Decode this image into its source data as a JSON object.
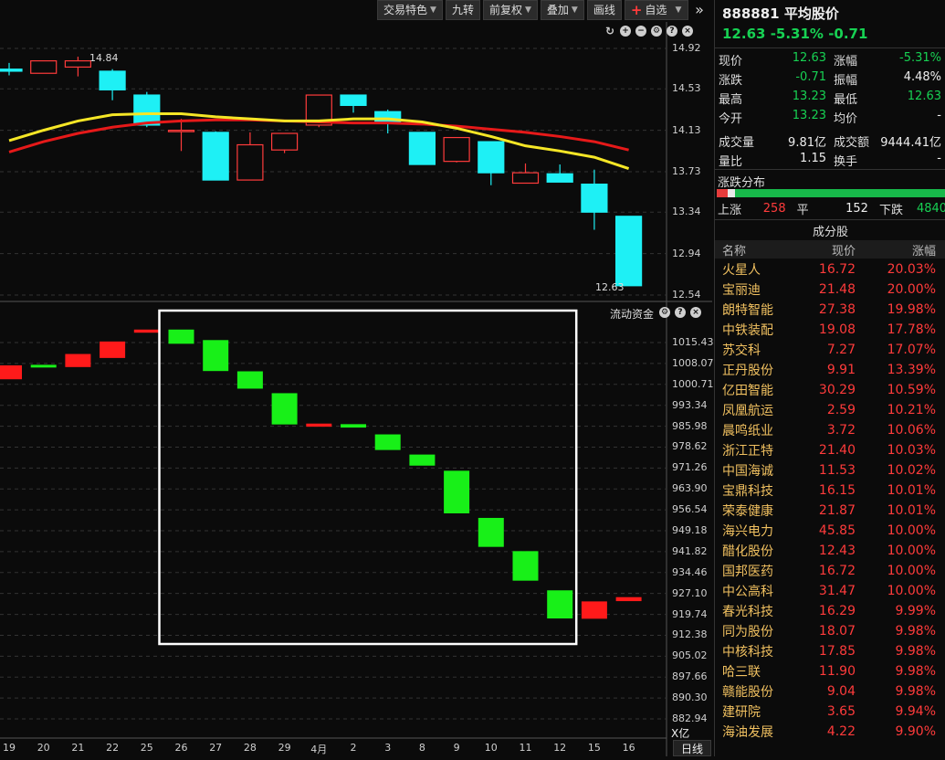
{
  "toolbar": {
    "items": [
      {
        "label": "交易特色",
        "dropdown": true
      },
      {
        "label": "九转",
        "dropdown": false
      },
      {
        "label": "前复权",
        "dropdown": true
      },
      {
        "label": "叠加",
        "dropdown": true
      },
      {
        "label": "画线",
        "dropdown": false
      }
    ],
    "watchlist_label": "自选",
    "more_icon": "double-chevron-right"
  },
  "price_chart": {
    "y_ticks": [
      "14.92",
      "14.53",
      "14.13",
      "13.73",
      "13.34",
      "12.94",
      "12.54"
    ],
    "high_label": "14.84",
    "low_label": "12.63",
    "colors": {
      "up": "#ff3b3b",
      "down": "#1ef0f5",
      "ma_short": "#f5e626",
      "ma_long": "#e61919"
    }
  },
  "volume_chart": {
    "title": "流动资金",
    "y_ticks": [
      "1015.43",
      "1008.07",
      "1000.71",
      "993.34",
      "985.98",
      "978.62",
      "971.26",
      "963.90",
      "956.54",
      "949.18",
      "941.82",
      "934.46",
      "927.10",
      "919.74",
      "912.38",
      "905.02",
      "897.66",
      "890.30",
      "882.94"
    ],
    "unit_label": "X亿",
    "colors": {
      "up": "#ff1a1a",
      "down": "#18f018",
      "highlight_box": "#ffffff"
    }
  },
  "x_axis": {
    "labels": [
      "19",
      "20",
      "21",
      "22",
      "25",
      "26",
      "27",
      "28",
      "29",
      "4月",
      "2",
      "3",
      "8",
      "9",
      "10",
      "11",
      "12",
      "15",
      "16"
    ],
    "period_button": "日线"
  },
  "chart_data": [
    {
      "type": "candlestick",
      "categories": [
        "19",
        "20",
        "21",
        "22",
        "25",
        "26",
        "27",
        "28",
        "29",
        "4月",
        "2",
        "3",
        "8",
        "9",
        "10",
        "11",
        "12",
        "15",
        "16"
      ],
      "series": [
        {
          "open": 14.72,
          "close": 14.7,
          "high": 14.78,
          "low": 14.66
        },
        {
          "open": 14.68,
          "close": 14.8,
          "high": 14.8,
          "low": 14.68
        },
        {
          "open": 14.74,
          "close": 14.8,
          "high": 14.84,
          "low": 14.65
        },
        {
          "open": 14.7,
          "close": 14.52,
          "high": 14.72,
          "low": 14.42
        },
        {
          "open": 14.47,
          "close": 14.18,
          "high": 14.5,
          "low": 14.16
        },
        {
          "open": 14.13,
          "close": 14.13,
          "high": 14.24,
          "low": 13.93
        },
        {
          "open": 14.11,
          "close": 13.65,
          "high": 14.12,
          "low": 13.65
        },
        {
          "open": 13.65,
          "close": 13.99,
          "high": 14.11,
          "low": 13.65
        },
        {
          "open": 13.94,
          "close": 14.1,
          "high": 14.1,
          "low": 13.91
        },
        {
          "open": 14.18,
          "close": 14.47,
          "high": 14.47,
          "low": 14.16
        },
        {
          "open": 14.47,
          "close": 14.37,
          "high": 14.47,
          "low": 14.3
        },
        {
          "open": 14.31,
          "close": 14.21,
          "high": 14.33,
          "low": 14.1
        },
        {
          "open": 14.11,
          "close": 13.8,
          "high": 14.11,
          "low": 13.8
        },
        {
          "open": 13.83,
          "close": 14.06,
          "high": 14.06,
          "low": 13.82
        },
        {
          "open": 14.02,
          "close": 13.72,
          "high": 14.02,
          "low": 13.6
        },
        {
          "open": 13.62,
          "close": 13.72,
          "high": 13.81,
          "low": 13.62
        },
        {
          "open": 13.71,
          "close": 13.63,
          "high": 13.8,
          "low": 13.63
        },
        {
          "open": 13.61,
          "close": 13.34,
          "high": 13.75,
          "low": 13.17
        },
        {
          "open": 13.3,
          "close": 12.63,
          "high": 13.3,
          "low": 12.63
        }
      ],
      "ma_short": [
        14.03,
        14.13,
        14.22,
        14.28,
        14.29,
        14.29,
        14.26,
        14.24,
        14.22,
        14.22,
        14.24,
        14.24,
        14.21,
        14.15,
        14.07,
        13.98,
        13.93,
        13.87,
        13.76
      ],
      "ma_long": [
        13.92,
        14.02,
        14.1,
        14.16,
        14.2,
        14.22,
        14.23,
        14.23,
        14.22,
        14.21,
        14.2,
        14.2,
        14.19,
        14.17,
        14.14,
        14.11,
        14.07,
        14.02,
        13.94
      ],
      "ylim": [
        12.54,
        14.92
      ]
    },
    {
      "type": "bar",
      "categories": [
        "19",
        "20",
        "21",
        "22",
        "25",
        "26",
        "27",
        "28",
        "29",
        "4月",
        "2",
        "3",
        "8",
        "9",
        "10",
        "11",
        "12",
        "15",
        "16"
      ],
      "series": [
        {
          "from": 1007.4,
          "to": 1002.5,
          "dir": "up"
        },
        {
          "from": 1007.6,
          "to": 1007.0,
          "dir": "down"
        },
        {
          "from": 1011.4,
          "to": 1006.8,
          "dir": "up"
        },
        {
          "from": 1015.8,
          "to": 1010.0,
          "dir": "up"
        },
        {
          "from": 1020.0,
          "to": 1018.9,
          "dir": "up"
        },
        {
          "from": 1020.0,
          "to": 1015.0,
          "dir": "down"
        },
        {
          "from": 1016.3,
          "to": 1005.4,
          "dir": "down"
        },
        {
          "from": 1005.3,
          "to": 999.2,
          "dir": "down"
        },
        {
          "from": 997.6,
          "to": 986.6,
          "dir": "down"
        },
        {
          "from": 986.9,
          "to": 985.8,
          "dir": "up"
        },
        {
          "from": 986.7,
          "to": 985.5,
          "dir": "down"
        },
        {
          "from": 983.1,
          "to": 977.6,
          "dir": "down"
        },
        {
          "from": 976.0,
          "to": 972.1,
          "dir": "down"
        },
        {
          "from": 970.3,
          "to": 955.3,
          "dir": "down"
        },
        {
          "from": 953.7,
          "to": 943.5,
          "dir": "down"
        },
        {
          "from": 942.0,
          "to": 931.6,
          "dir": "down"
        },
        {
          "from": 928.2,
          "to": 918.3,
          "dir": "down"
        },
        {
          "from": 924.3,
          "to": 918.2,
          "dir": "up"
        },
        {
          "from": 925.8,
          "to": 924.4,
          "dir": "up"
        }
      ],
      "highlight_range": [
        "26",
        "12"
      ],
      "ylim": [
        882.94,
        1020.0
      ]
    }
  ],
  "sidebar": {
    "code": "888881",
    "name": "平均股价",
    "price": "12.63",
    "change_pct": "-5.31%",
    "change": "-0.71",
    "quote_rows": [
      [
        {
          "k": "现价",
          "v": "12.63",
          "c": "green"
        },
        {
          "k": "涨幅",
          "v": "-5.31%",
          "c": "green"
        }
      ],
      [
        {
          "k": "涨跌",
          "v": "-0.71",
          "c": "green"
        },
        {
          "k": "振幅",
          "v": "4.48%",
          "c": "white"
        }
      ],
      [
        {
          "k": "最高",
          "v": "13.23",
          "c": "green"
        },
        {
          "k": "最低",
          "v": "12.63",
          "c": "green"
        }
      ],
      [
        {
          "k": "今开",
          "v": "13.23",
          "c": "green"
        },
        {
          "k": "均价",
          "v": "-",
          "c": "white"
        }
      ],
      [
        {
          "k": "成交量",
          "v": "9.81亿",
          "c": "white"
        },
        {
          "k": "成交额",
          "v": "9444.41亿",
          "c": "white"
        }
      ],
      [
        {
          "k": "量比",
          "v": "1.15",
          "c": "white"
        },
        {
          "k": "换手",
          "v": "-",
          "c": "white"
        }
      ]
    ],
    "distribution": {
      "title": "涨跌分布",
      "up_label": "上涨",
      "up_count": "258",
      "flat_label": "平",
      "flat_count": "152",
      "down_label": "下跌",
      "down_count": "4840",
      "up_fraction": 0.049,
      "flat_fraction": 0.029,
      "down_fraction": 0.922
    },
    "constituents": {
      "title": "成分股",
      "headers": [
        "名称",
        "现价",
        "涨幅"
      ],
      "rows": [
        [
          "火星人",
          "16.72",
          "20.03%"
        ],
        [
          "宝丽迪",
          "21.48",
          "20.00%"
        ],
        [
          "朗特智能",
          "27.38",
          "19.98%"
        ],
        [
          "中铁装配",
          "19.08",
          "17.78%"
        ],
        [
          "苏交科",
          "7.27",
          "17.07%"
        ],
        [
          "正丹股份",
          "9.91",
          "13.39%"
        ],
        [
          "亿田智能",
          "30.29",
          "10.59%"
        ],
        [
          "凤凰航运",
          "2.59",
          "10.21%"
        ],
        [
          "晨鸣纸业",
          "3.72",
          "10.06%"
        ],
        [
          "浙江正特",
          "21.40",
          "10.03%"
        ],
        [
          "中国海诚",
          "11.53",
          "10.02%"
        ],
        [
          "宝鼎科技",
          "16.15",
          "10.01%"
        ],
        [
          "荣泰健康",
          "21.87",
          "10.01%"
        ],
        [
          "海兴电力",
          "45.85",
          "10.00%"
        ],
        [
          "醋化股份",
          "12.43",
          "10.00%"
        ],
        [
          "国邦医药",
          "16.72",
          "10.00%"
        ],
        [
          "中公高科",
          "31.47",
          "10.00%"
        ],
        [
          "春光科技",
          "16.29",
          "9.99%"
        ],
        [
          "同为股份",
          "18.07",
          "9.98%"
        ],
        [
          "中核科技",
          "17.85",
          "9.98%"
        ],
        [
          "哈三联",
          "11.90",
          "9.98%"
        ],
        [
          "赣能股份",
          "9.04",
          "9.98%"
        ],
        [
          "建研院",
          "3.65",
          "9.94%"
        ],
        [
          "海油发展",
          "4.22",
          "9.90%"
        ]
      ]
    }
  }
}
